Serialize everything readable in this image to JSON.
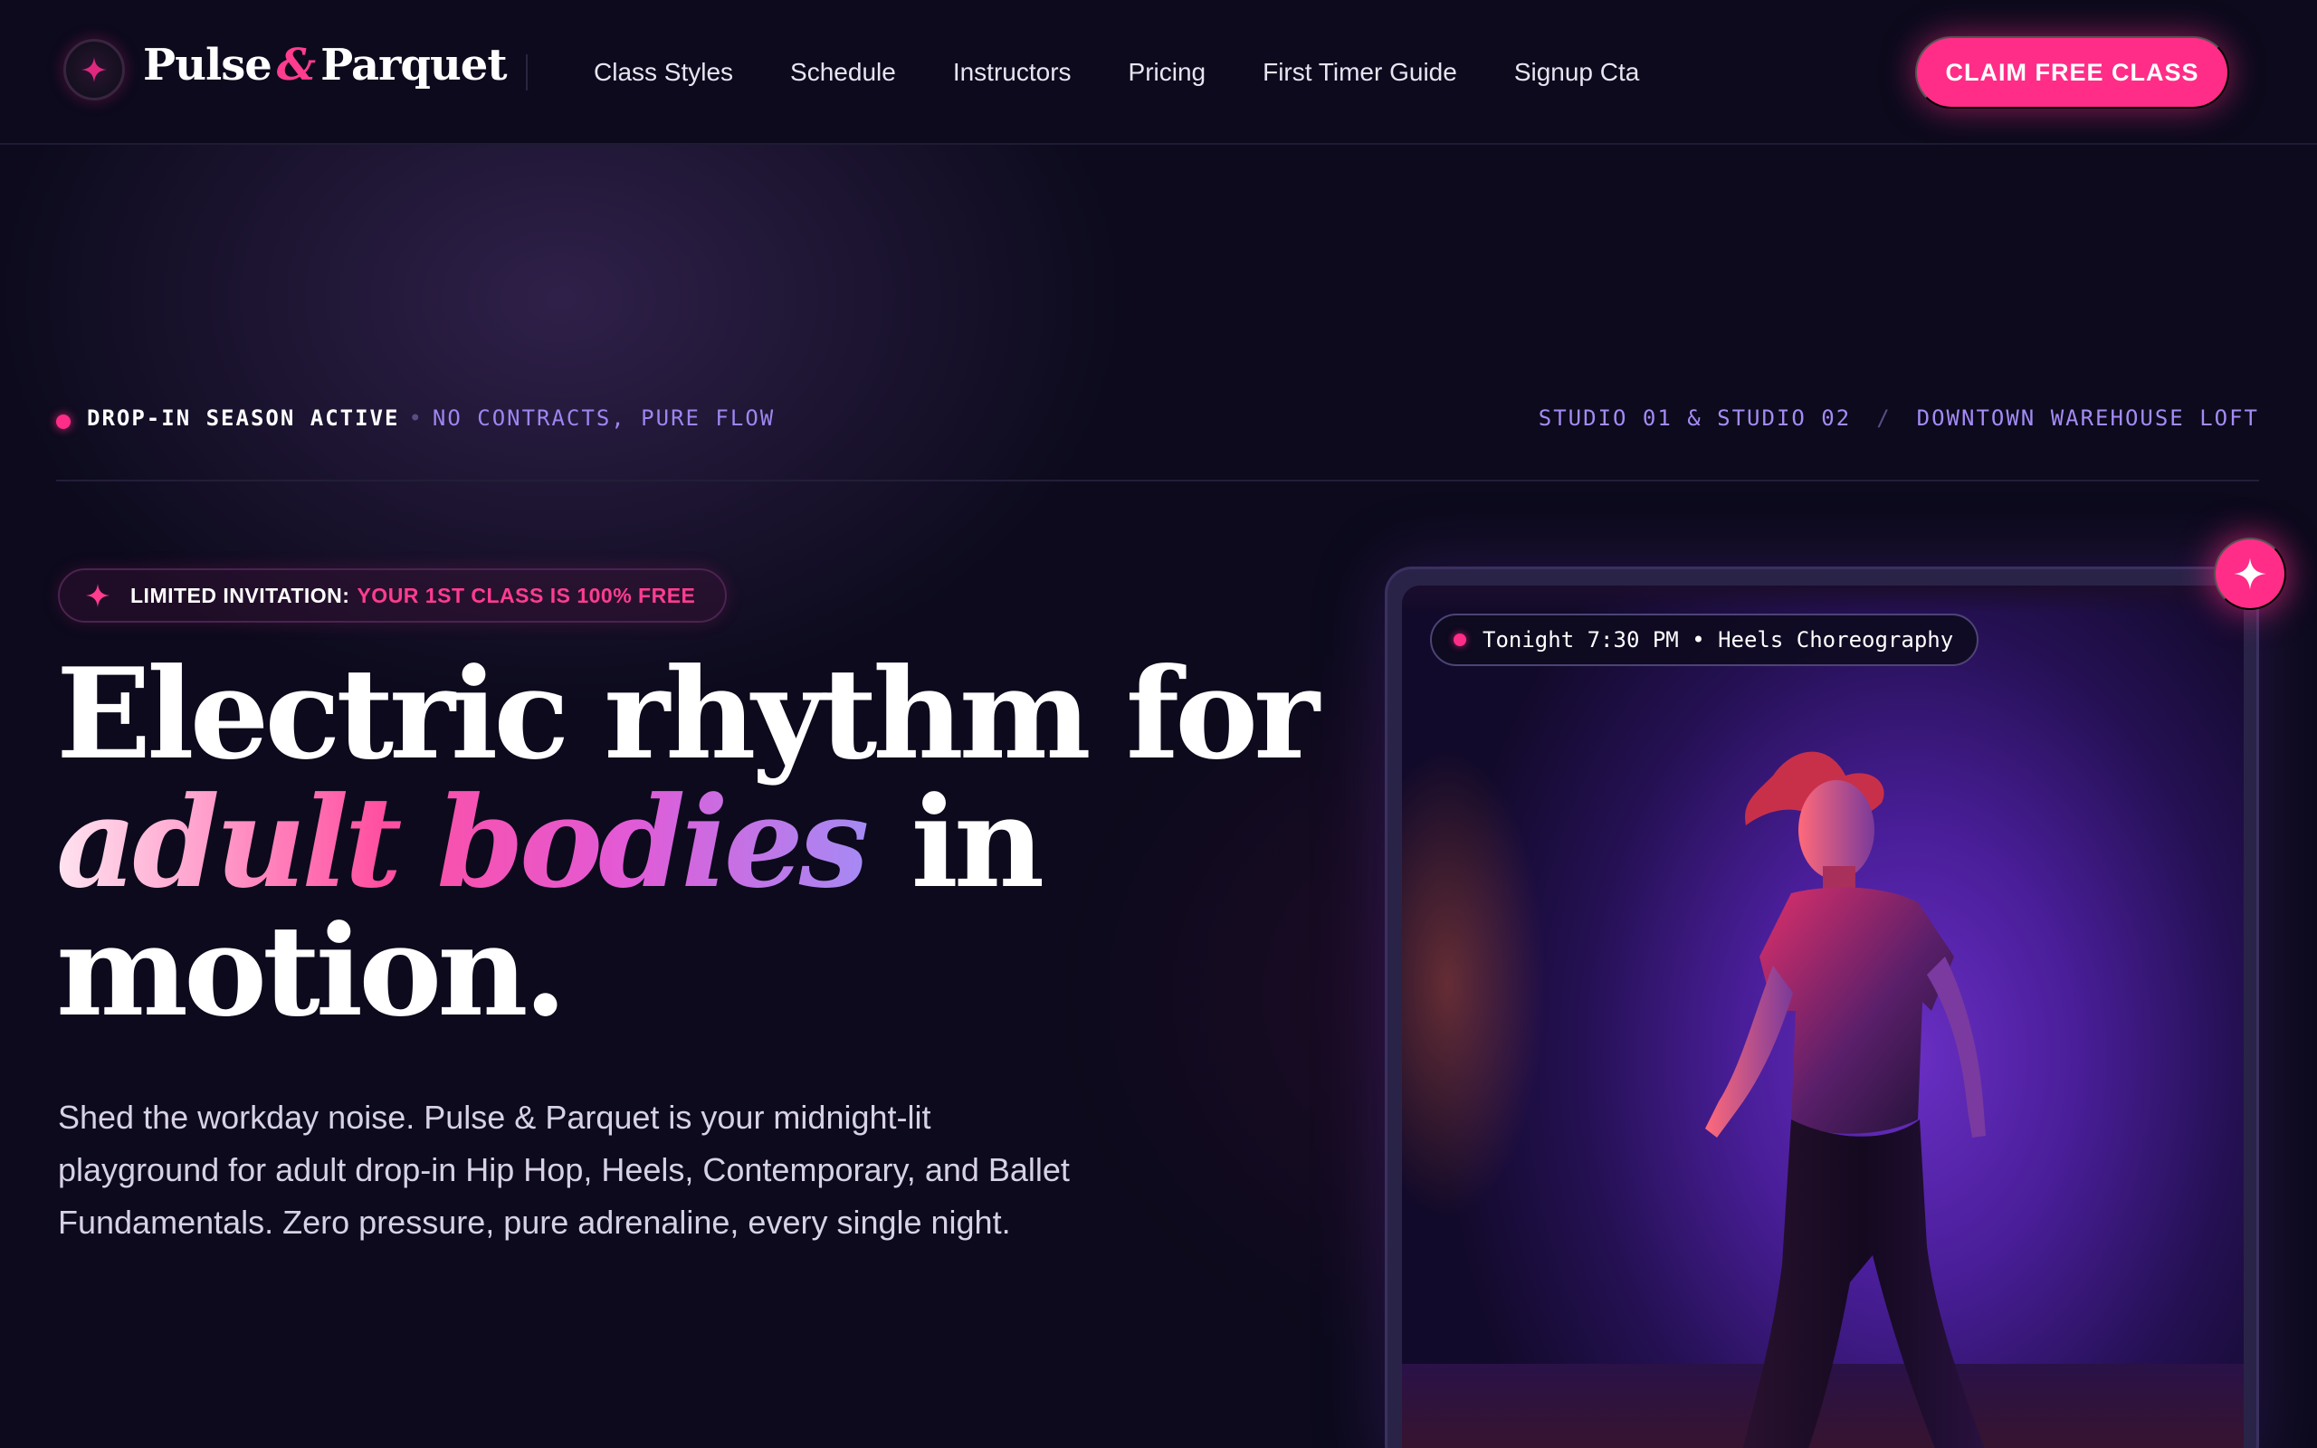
{
  "brand": {
    "name_part1": "Pulse",
    "ampersand": "&",
    "name_part2": "Parquet",
    "logo_icon": "sparkle-icon"
  },
  "nav": {
    "links": [
      "Class Styles",
      "Schedule",
      "Instructors",
      "Pricing",
      "First Timer Guide",
      "Signup Cta"
    ],
    "cta_label": "CLAIM FREE CLASS"
  },
  "status": {
    "active_label": "DROP-IN SEASON ACTIVE",
    "bullet": "•",
    "sub_label": "NO CONTRACTS, PURE FLOW",
    "location_studios": "STUDIO 01 & STUDIO 02",
    "location_slash": "/",
    "location_place": "DOWNTOWN WAREHOUSE LOFT"
  },
  "badge": {
    "label": "LIMITED INVITATION:",
    "highlight": "YOUR 1ST CLASS IS 100% FREE"
  },
  "hero": {
    "headline_line1": "Electric rhythm for",
    "headline_gradient": "adult bodies",
    "headline_line2_rest": " in",
    "headline_line3": "motion.",
    "lede": "Shed the workday noise. Pulse & Parquet is your midnight-lit playground for adult drop-in Hip Hop, Heels, Contemporary, and Ballet Fundamentals. Zero pressure, pure adrenaline, every single night."
  },
  "photo_card": {
    "tag": "Tonight 7:30 PM • Heels Choreography",
    "action_icon": "sparkle-icon"
  },
  "colors": {
    "accent": "#ff2d87",
    "background": "#0c0a1c",
    "lavender": "#a48bf5"
  }
}
